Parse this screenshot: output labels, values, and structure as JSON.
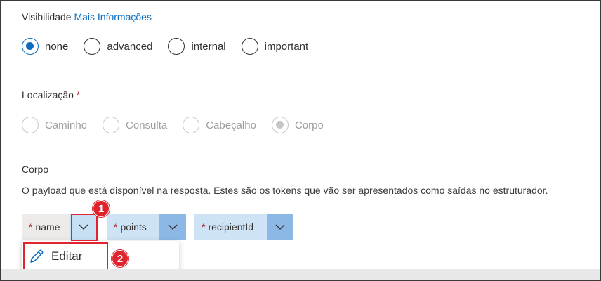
{
  "visibility": {
    "label": "Visibilidade",
    "more_info_link": "Mais Informações",
    "options": [
      "none",
      "advanced",
      "internal",
      "important"
    ],
    "selected": "none"
  },
  "location": {
    "label": "Localização",
    "required_mark": "*",
    "options": [
      "Caminho",
      "Consulta",
      "Cabeçalho",
      "Corpo"
    ],
    "selected": "Corpo",
    "disabled": true
  },
  "body": {
    "label": "Corpo",
    "description": "O payload que está disponível na resposta. Estes são os tokens que vão ser apresentados como saídas no estruturador.",
    "tokens": [
      {
        "required_mark": "*",
        "label": "name"
      },
      {
        "required_mark": "*",
        "label": "points"
      },
      {
        "required_mark": "*",
        "label": "recipientId"
      }
    ]
  },
  "dropdown_menu": {
    "items": [
      {
        "label": "Editar",
        "icon": "pencil-icon"
      }
    ]
  },
  "annotations": {
    "step1": "1",
    "step2": "2",
    "color": "#e0242d"
  },
  "colors": {
    "accent": "#0f6cbd",
    "required": "#a4262c"
  }
}
